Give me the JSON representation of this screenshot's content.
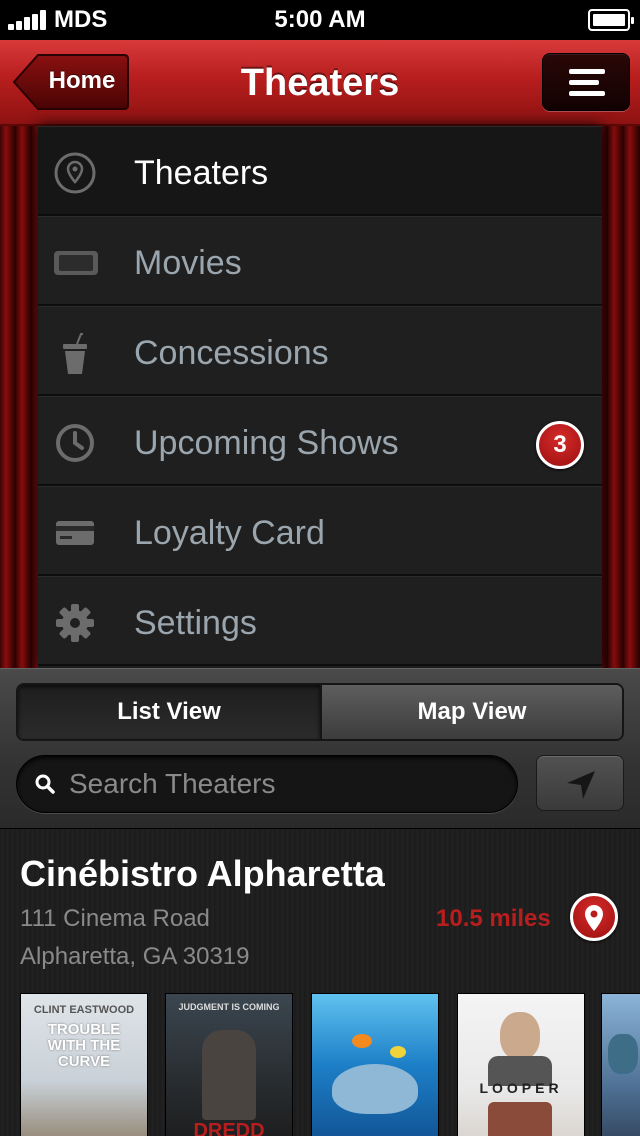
{
  "status_bar": {
    "carrier": "MDS",
    "time": "5:00 AM"
  },
  "nav": {
    "back_label": "Home",
    "title": "Theaters"
  },
  "menu": {
    "items": [
      {
        "label": "Theaters",
        "icon": "location-icon",
        "active": true
      },
      {
        "label": "Movies",
        "icon": "ticket-icon",
        "active": false
      },
      {
        "label": "Concessions",
        "icon": "drink-cup-icon",
        "active": false
      },
      {
        "label": "Upcoming Shows",
        "icon": "clock-icon",
        "active": false,
        "badge": "3"
      },
      {
        "label": "Loyalty Card",
        "icon": "card-icon",
        "active": false
      },
      {
        "label": "Settings",
        "icon": "gear-icon",
        "active": false
      }
    ]
  },
  "view_toggle": {
    "list_label": "List View",
    "map_label": "Map View",
    "selected": "List View"
  },
  "search": {
    "placeholder": "Search Theaters"
  },
  "theater": {
    "name": "Cinébistro Alpharetta",
    "address_line1": "111 Cinema Road",
    "address_line2": "Alpharetta, GA 30319",
    "distance": "10.5 miles"
  },
  "posters": [
    {
      "title_top": "CLINT EASTWOOD",
      "title_main": "TROUBLE WITH THE CURVE"
    },
    {
      "title_top": "JUDGMENT IS COMING",
      "title_main": "DREDD"
    },
    {
      "title_top": "",
      "title_main": ""
    },
    {
      "title_top": "",
      "title_main": "LOOPER"
    },
    {
      "title_top": "",
      "title_main": ""
    }
  ],
  "colors": {
    "accent_red": "#b81e1e",
    "menu_bg": "#1f1f1f",
    "text_muted": "#9aa5ad"
  }
}
